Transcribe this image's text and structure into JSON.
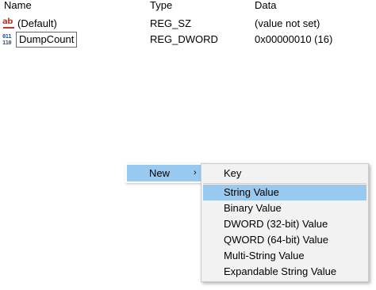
{
  "columns": {
    "name": "Name",
    "type": "Type",
    "data": "Data"
  },
  "rows": [
    {
      "icon": "string-value-icon",
      "name": "(Default)",
      "type": "REG_SZ",
      "data": "(value not set)"
    },
    {
      "icon": "binary-value-icon",
      "name": "DumpCount",
      "type": "REG_DWORD",
      "data": "0x00000010 (16)"
    }
  ],
  "icons": {
    "string_glyph": "ab",
    "binary_glyph": "011\n110"
  },
  "context_menu": {
    "new_label": "New",
    "new_arrow": "›"
  },
  "new_submenu": {
    "items": [
      "Key",
      "String Value",
      "Binary Value",
      "DWORD (32-bit) Value",
      "QWORD (64-bit) Value",
      "Multi-String Value",
      "Expandable String Value"
    ],
    "highlighted": "String Value"
  },
  "colors": {
    "highlight": "#99c9ef",
    "menu_bg": "#f2f2f2",
    "string_icon": "#c0392b",
    "binary_icon": "#1f4fb6"
  }
}
